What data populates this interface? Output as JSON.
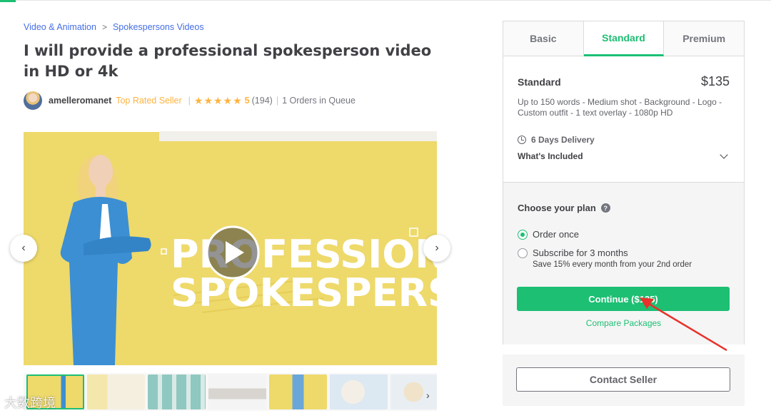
{
  "breadcrumb": {
    "category": "Video & Animation",
    "subcategory": "Spokespersons Videos",
    "separator": ">"
  },
  "gig": {
    "title": "I will provide a professional spokesperson video in HD or 4k"
  },
  "seller": {
    "username": "amelleromanet",
    "level": "Top Rated Seller",
    "stars": "★★★★★",
    "rating": "5",
    "reviews": "(194)",
    "queue": "1 Orders in Queue"
  },
  "gallery": {
    "line1": "PROFESSIONAL",
    "line2": "SPOKESPERSON",
    "prev_icon": "‹",
    "next_icon": "›",
    "thumb_next_icon": "›",
    "background_color": "#eed96b"
  },
  "packages": {
    "tabs": [
      "Basic",
      "Standard",
      "Premium"
    ],
    "active_tab": "Standard",
    "name": "Standard",
    "price": "$135",
    "description": "Up to 150 words - Medium shot - Background - Logo - Custom outfit - 1 text overlay - 1080p HD",
    "delivery": "6 Days Delivery",
    "included_label": "What's Included"
  },
  "plan": {
    "title": "Choose your plan",
    "help_icon": "?",
    "option_once": "Order once",
    "option_subscribe": "Subscribe for 3 months",
    "subscribe_note": "Save 15% every month from your 2nd order",
    "selected": "Order once"
  },
  "actions": {
    "continue_label": "Continue ($135)",
    "compare_label": "Compare Packages",
    "contact_label": "Contact Seller"
  },
  "watermark": {
    "text": "大数跨境"
  },
  "colors": {
    "brand_green": "#1dbf73",
    "star": "#ffb33e",
    "link_blue": "#446ee7",
    "annotation_red": "#e8322b"
  }
}
